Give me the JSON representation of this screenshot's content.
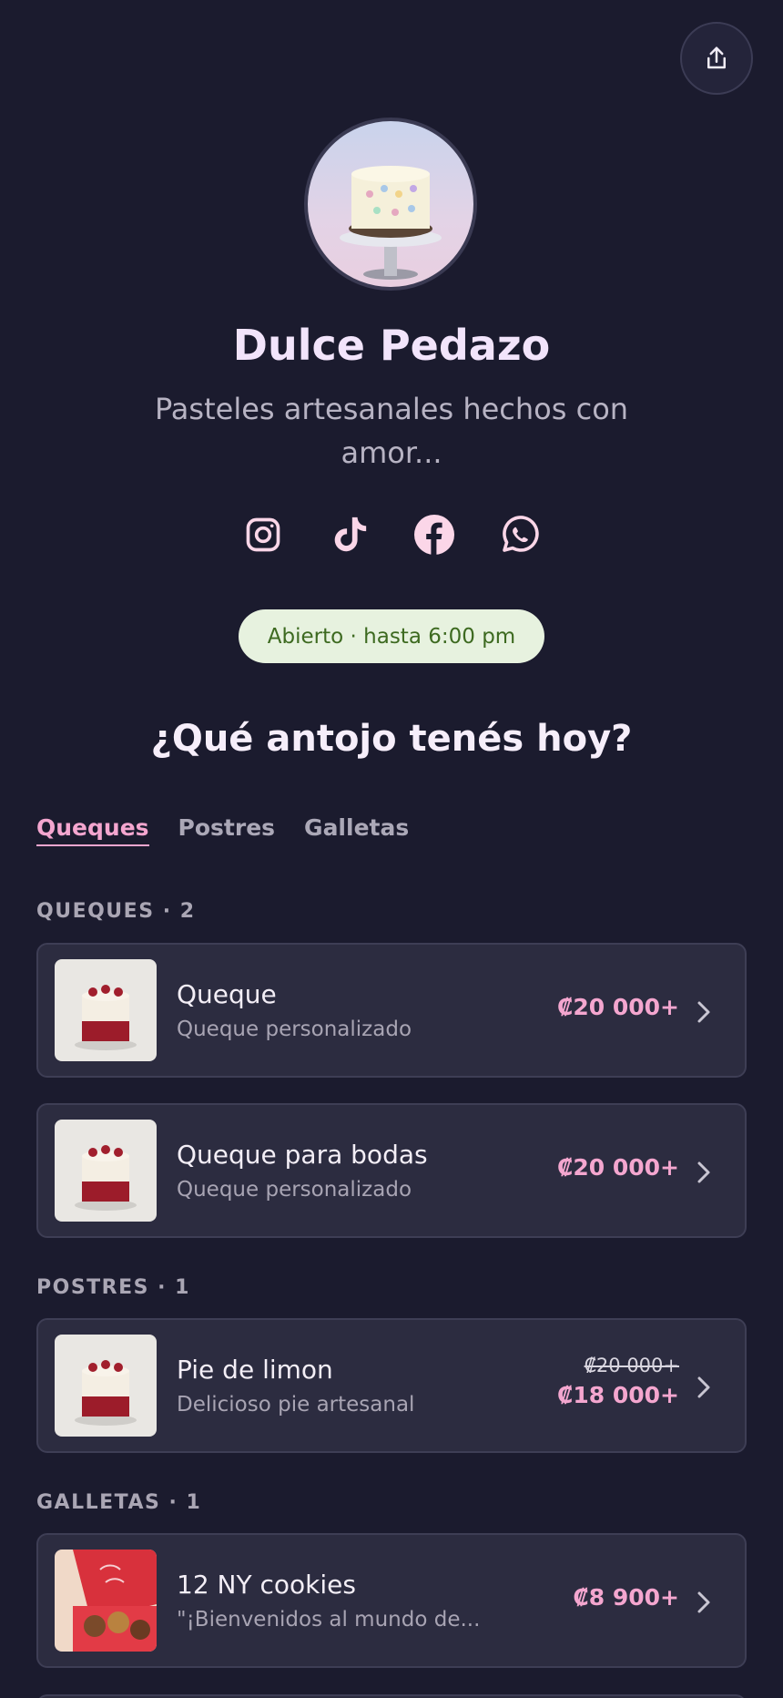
{
  "profile": {
    "name": "Dulce Pedazo",
    "tagline": "Pasteles artesanales hechos con amor...",
    "status": "Abierto · hasta 6:00 pm"
  },
  "socials": [
    {
      "icon": "instagram-icon"
    },
    {
      "icon": "tiktok-icon"
    },
    {
      "icon": "facebook-icon"
    },
    {
      "icon": "whatsapp-icon"
    }
  ],
  "menu": {
    "heading": "¿Qué antojo tenés hoy?",
    "tabs": [
      "Queques",
      "Postres",
      "Galletas"
    ],
    "active_tab": "Queques",
    "sections": [
      {
        "label": "QUEQUES · 2",
        "items": [
          {
            "title": "Queque",
            "subtitle": "Queque personalizado",
            "price": "₡20 000+"
          },
          {
            "title": "Queque para bodas",
            "subtitle": "Queque personalizado",
            "price": "₡20 000+"
          }
        ]
      },
      {
        "label": "POSTRES · 1",
        "items": [
          {
            "title": "Pie de limon",
            "subtitle": "Delicioso pie artesanal",
            "price_old": "₡20 000+",
            "price": "₡18 000+"
          }
        ]
      },
      {
        "label": "GALLETAS · 1",
        "items": [
          {
            "title": "12 NY cookies",
            "subtitle": "\"¡Bienvenidos al mundo de...",
            "price": "₡8 900+"
          }
        ]
      }
    ]
  },
  "colors": {
    "background": "#1b1b2e",
    "accent_pink": "#f4a6cf",
    "card": "#2c2c40",
    "status_bg": "#e7f2df",
    "status_text": "#3d6a20"
  }
}
